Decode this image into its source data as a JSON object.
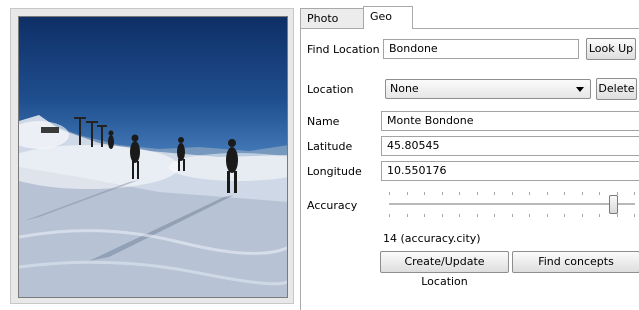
{
  "tabs": [
    {
      "label": "Photo Info",
      "active": false
    },
    {
      "label": "Geo",
      "active": true
    }
  ],
  "geo": {
    "find_location_label": "Find Location",
    "find_location_value": "Bondone",
    "look_up_button": "Look Up",
    "location_label": "Location",
    "location_selected": "None",
    "delete_button": "Delete",
    "name_label": "Name",
    "name_value": "Monte Bondone",
    "latitude_label": "Latitude",
    "latitude_value": "45.80545",
    "longitude_label": "Longitude",
    "longitude_value": "10.550176",
    "accuracy_label": "Accuracy",
    "accuracy_level_fraction": 0.93,
    "accuracy_text": "14 (accuracy.city)",
    "create_update_button": "Create/Update Location",
    "find_concepts_button": "Find concepts"
  },
  "photo": {
    "description_icon": "photo-thumbnail"
  }
}
